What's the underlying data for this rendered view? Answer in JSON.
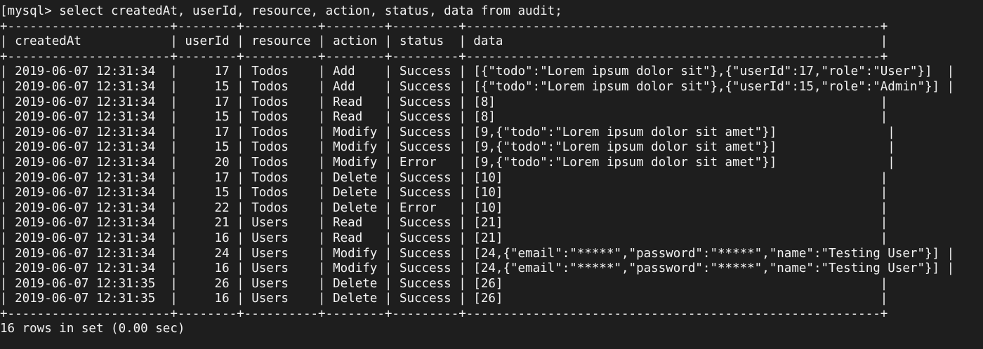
{
  "terminal": {
    "prompt": "[mysql> ",
    "command": "select createdAt, userId, resource, action, status, data from audit;",
    "border": "+----------------------+--------+----------+--------+---------+--------------------------------------------------------+",
    "header": "| createdAt            | userId | resource | action | status  | data                                                   |",
    "rows": [
      "| 2019-06-07 12:31:34  |     17 | Todos    | Add    | Success | [{\"todo\":\"Lorem ipsum dolor sit\"},{\"userId\":17,\"role\":\"User\"}]  |",
      "| 2019-06-07 12:31:34  |     15 | Todos    | Add    | Success | [{\"todo\":\"Lorem ipsum dolor sit\"},{\"userId\":15,\"role\":\"Admin\"}] |",
      "| 2019-06-07 12:31:34  |     17 | Todos    | Read   | Success | [8]                                                    |",
      "| 2019-06-07 12:31:34  |     15 | Todos    | Read   | Success | [8]                                                    |",
      "| 2019-06-07 12:31:34  |     17 | Todos    | Modify | Success | [9,{\"todo\":\"Lorem ipsum dolor sit amet\"}]               |",
      "| 2019-06-07 12:31:34  |     15 | Todos    | Modify | Success | [9,{\"todo\":\"Lorem ipsum dolor sit amet\"}]               |",
      "| 2019-06-07 12:31:34  |     20 | Todos    | Modify | Error   | [9,{\"todo\":\"Lorem ipsum dolor sit amet\"}]               |",
      "| 2019-06-07 12:31:34  |     17 | Todos    | Delete | Success | [10]                                                   |",
      "| 2019-06-07 12:31:34  |     15 | Todos    | Delete | Success | [10]                                                   |",
      "| 2019-06-07 12:31:34  |     22 | Todos    | Delete | Error   | [10]                                                   |",
      "| 2019-06-07 12:31:34  |     21 | Users    | Read   | Success | [21]                                                   |",
      "| 2019-06-07 12:31:34  |     16 | Users    | Read   | Success | [21]                                                   |",
      "| 2019-06-07 12:31:34  |     24 | Users    | Modify | Success | [24,{\"email\":\"*****\",\"password\":\"*****\",\"name\":\"Testing User\"}] |",
      "| 2019-06-07 12:31:34  |     16 | Users    | Modify | Success | [24,{\"email\":\"*****\",\"password\":\"*****\",\"name\":\"Testing User\"}] |",
      "| 2019-06-07 12:31:35  |     26 | Users    | Delete | Success | [26]                                                   |",
      "| 2019-06-07 12:31:35  |     16 | Users    | Delete | Success | [26]                                                   |"
    ],
    "footer": "16 rows in set (0.00 sec)"
  }
}
